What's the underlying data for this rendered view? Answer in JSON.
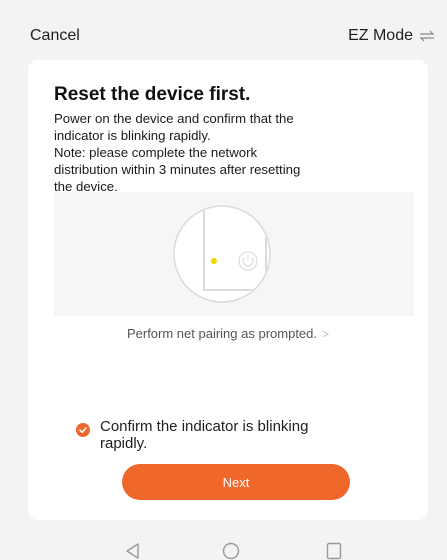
{
  "topbar": {
    "cancel_label": "Cancel",
    "mode_label": "EZ Mode"
  },
  "card": {
    "title": "Reset the device first.",
    "description": [
      "Power on the device and confirm that the",
      "indicator is blinking rapidly.",
      "Note: please complete the network",
      "distribution within 3 minutes after resetting",
      "the device."
    ],
    "pairing_link": "Perform net pairing as prompted.",
    "pairing_chevron": ">",
    "confirm_label_line1": "Confirm the indicator is blinking",
    "confirm_label_line2": "rapidly.",
    "confirm_checked": true,
    "next_label": "Next"
  },
  "colors": {
    "accent": "#f0672c",
    "indicator": "#f5d300"
  },
  "icons": {
    "mode": "switch-arrows-icon",
    "check": "checkmark-icon",
    "power": "power-icon",
    "nav_back": "back-triangle-icon",
    "nav_home": "home-circle-icon",
    "nav_recent": "recent-square-icon"
  }
}
